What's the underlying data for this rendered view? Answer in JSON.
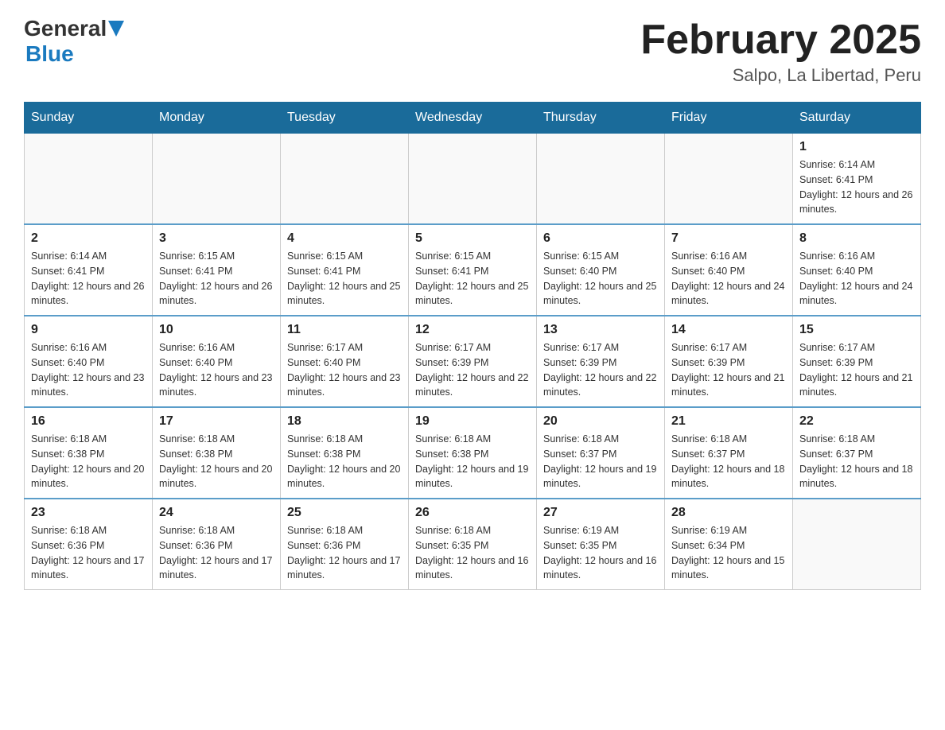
{
  "header": {
    "logo": {
      "general": "General",
      "triangle": "▶",
      "blue": "Blue"
    },
    "title": "February 2025",
    "location": "Salpo, La Libertad, Peru"
  },
  "days_of_week": [
    "Sunday",
    "Monday",
    "Tuesday",
    "Wednesday",
    "Thursday",
    "Friday",
    "Saturday"
  ],
  "weeks": [
    [
      {
        "day": "",
        "info": ""
      },
      {
        "day": "",
        "info": ""
      },
      {
        "day": "",
        "info": ""
      },
      {
        "day": "",
        "info": ""
      },
      {
        "day": "",
        "info": ""
      },
      {
        "day": "",
        "info": ""
      },
      {
        "day": "1",
        "info": "Sunrise: 6:14 AM\nSunset: 6:41 PM\nDaylight: 12 hours and 26 minutes."
      }
    ],
    [
      {
        "day": "2",
        "info": "Sunrise: 6:14 AM\nSunset: 6:41 PM\nDaylight: 12 hours and 26 minutes."
      },
      {
        "day": "3",
        "info": "Sunrise: 6:15 AM\nSunset: 6:41 PM\nDaylight: 12 hours and 26 minutes."
      },
      {
        "day": "4",
        "info": "Sunrise: 6:15 AM\nSunset: 6:41 PM\nDaylight: 12 hours and 25 minutes."
      },
      {
        "day": "5",
        "info": "Sunrise: 6:15 AM\nSunset: 6:41 PM\nDaylight: 12 hours and 25 minutes."
      },
      {
        "day": "6",
        "info": "Sunrise: 6:15 AM\nSunset: 6:40 PM\nDaylight: 12 hours and 25 minutes."
      },
      {
        "day": "7",
        "info": "Sunrise: 6:16 AM\nSunset: 6:40 PM\nDaylight: 12 hours and 24 minutes."
      },
      {
        "day": "8",
        "info": "Sunrise: 6:16 AM\nSunset: 6:40 PM\nDaylight: 12 hours and 24 minutes."
      }
    ],
    [
      {
        "day": "9",
        "info": "Sunrise: 6:16 AM\nSunset: 6:40 PM\nDaylight: 12 hours and 23 minutes."
      },
      {
        "day": "10",
        "info": "Sunrise: 6:16 AM\nSunset: 6:40 PM\nDaylight: 12 hours and 23 minutes."
      },
      {
        "day": "11",
        "info": "Sunrise: 6:17 AM\nSunset: 6:40 PM\nDaylight: 12 hours and 23 minutes."
      },
      {
        "day": "12",
        "info": "Sunrise: 6:17 AM\nSunset: 6:39 PM\nDaylight: 12 hours and 22 minutes."
      },
      {
        "day": "13",
        "info": "Sunrise: 6:17 AM\nSunset: 6:39 PM\nDaylight: 12 hours and 22 minutes."
      },
      {
        "day": "14",
        "info": "Sunrise: 6:17 AM\nSunset: 6:39 PM\nDaylight: 12 hours and 21 minutes."
      },
      {
        "day": "15",
        "info": "Sunrise: 6:17 AM\nSunset: 6:39 PM\nDaylight: 12 hours and 21 minutes."
      }
    ],
    [
      {
        "day": "16",
        "info": "Sunrise: 6:18 AM\nSunset: 6:38 PM\nDaylight: 12 hours and 20 minutes."
      },
      {
        "day": "17",
        "info": "Sunrise: 6:18 AM\nSunset: 6:38 PM\nDaylight: 12 hours and 20 minutes."
      },
      {
        "day": "18",
        "info": "Sunrise: 6:18 AM\nSunset: 6:38 PM\nDaylight: 12 hours and 20 minutes."
      },
      {
        "day": "19",
        "info": "Sunrise: 6:18 AM\nSunset: 6:38 PM\nDaylight: 12 hours and 19 minutes."
      },
      {
        "day": "20",
        "info": "Sunrise: 6:18 AM\nSunset: 6:37 PM\nDaylight: 12 hours and 19 minutes."
      },
      {
        "day": "21",
        "info": "Sunrise: 6:18 AM\nSunset: 6:37 PM\nDaylight: 12 hours and 18 minutes."
      },
      {
        "day": "22",
        "info": "Sunrise: 6:18 AM\nSunset: 6:37 PM\nDaylight: 12 hours and 18 minutes."
      }
    ],
    [
      {
        "day": "23",
        "info": "Sunrise: 6:18 AM\nSunset: 6:36 PM\nDaylight: 12 hours and 17 minutes."
      },
      {
        "day": "24",
        "info": "Sunrise: 6:18 AM\nSunset: 6:36 PM\nDaylight: 12 hours and 17 minutes."
      },
      {
        "day": "25",
        "info": "Sunrise: 6:18 AM\nSunset: 6:36 PM\nDaylight: 12 hours and 17 minutes."
      },
      {
        "day": "26",
        "info": "Sunrise: 6:18 AM\nSunset: 6:35 PM\nDaylight: 12 hours and 16 minutes."
      },
      {
        "day": "27",
        "info": "Sunrise: 6:19 AM\nSunset: 6:35 PM\nDaylight: 12 hours and 16 minutes."
      },
      {
        "day": "28",
        "info": "Sunrise: 6:19 AM\nSunset: 6:34 PM\nDaylight: 12 hours and 15 minutes."
      },
      {
        "day": "",
        "info": ""
      }
    ]
  ]
}
